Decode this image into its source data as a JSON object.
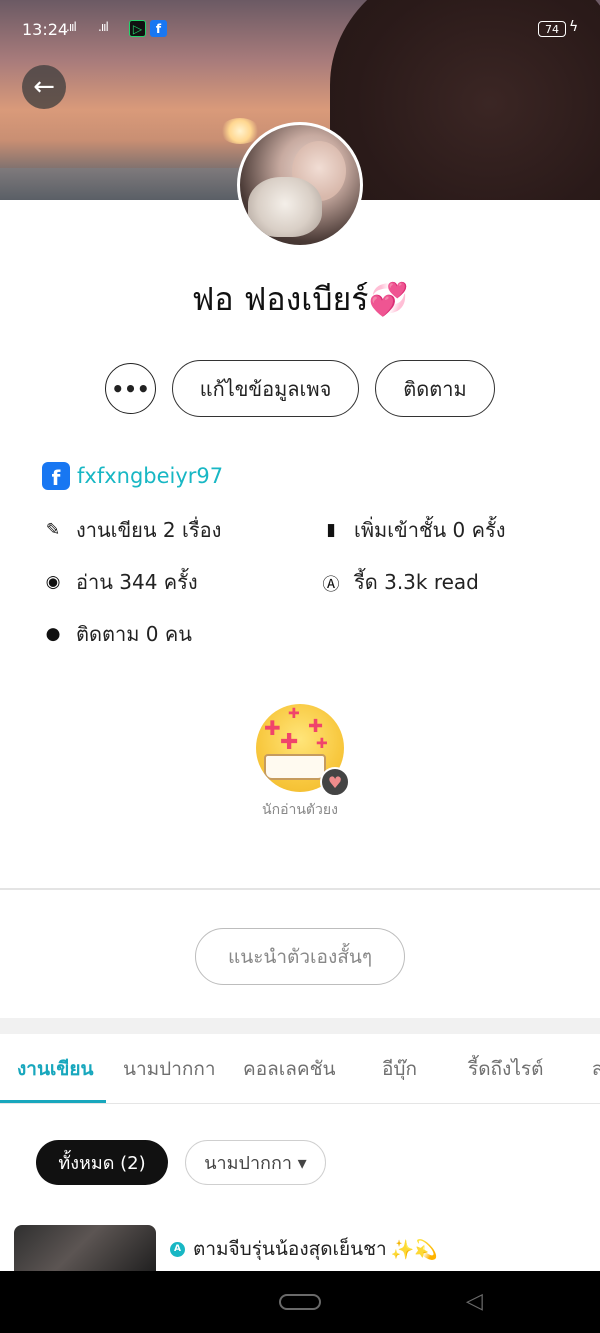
{
  "status_bar": {
    "time": "13:24",
    "signal1": ".ııl",
    "signal2": ".ııl",
    "battery": "74",
    "app_icons": [
      "line-icon",
      "facebook-icon"
    ]
  },
  "profile": {
    "name": "ฟอ ฟองเบียร์",
    "name_emoji": "💞",
    "buttons": {
      "more": "•••",
      "edit": "แก้ไขข้อมูลเพจ",
      "follow": "ติดตาม"
    },
    "facebook": "fxfxngbeiyr97",
    "stats": {
      "works": "งานเขียน 2 เรื่อง",
      "shelf": "เพิ่มเข้าชั้น 0 ครั้ง",
      "views": "อ่าน 344 ครั้ง",
      "reads": "รี้ด 3.3k read",
      "following": "ติดตาม 0 คน"
    },
    "badge_label": "นักอ่านตัวยง",
    "intro_button": "แนะนำตัวเองสั้นๆ"
  },
  "tabs": [
    {
      "label": "งานเขียน",
      "active": true
    },
    {
      "label": "นามปากกา"
    },
    {
      "label": "คอลเลคชัน"
    },
    {
      "label": "อีบุ๊ก"
    },
    {
      "label": "รี้ดถึงไรต์"
    },
    {
      "label": "ส"
    }
  ],
  "filters": {
    "all": "ทั้งหมด (2)",
    "pen_name": "นามปากกา ▾"
  },
  "story": {
    "badge": "A",
    "title": "ตามจีบรุ่นน้องสุดเย็นชา",
    "emoji": "✨",
    "emoji2": "💫"
  },
  "colors": {
    "accent": "#18a7bd",
    "link": "#18b7c4",
    "facebook": "#1877f2"
  }
}
